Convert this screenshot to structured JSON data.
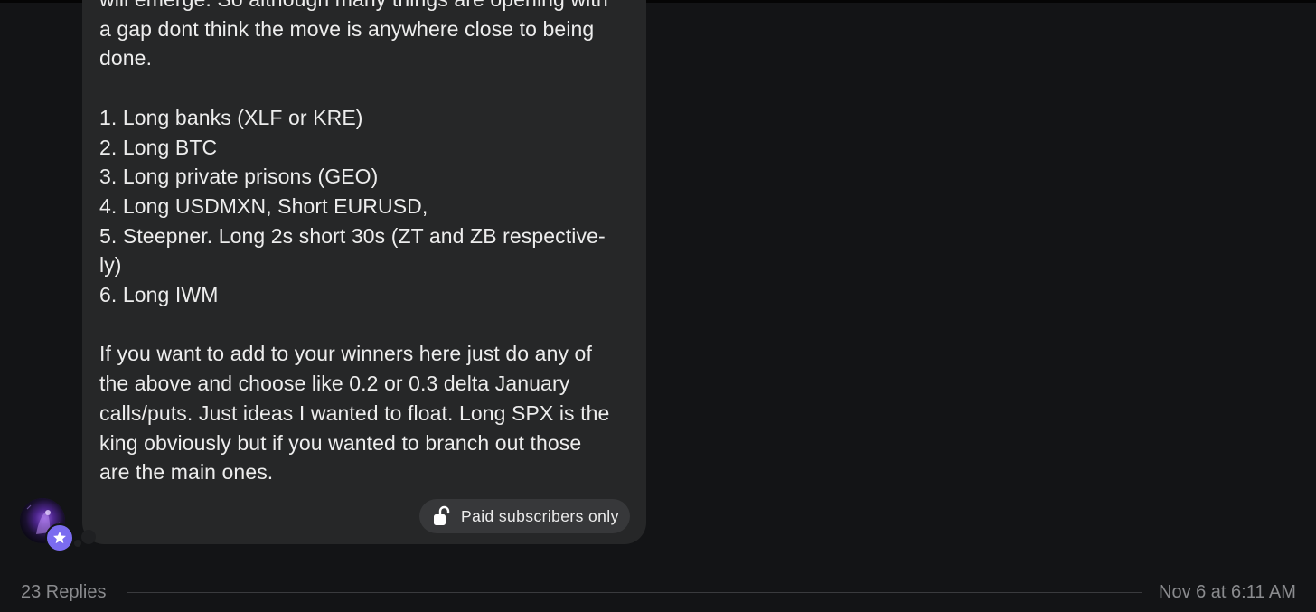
{
  "message": {
    "lines": [
      "will emerge. So although many things are opening with",
      "a gap dont think the move is anywhere close to being",
      "done.",
      "",
      "1. Long banks (XLF or KRE)",
      "2. Long BTC",
      "3. Long private prisons (GEO)",
      "4. Long USDMXN, Short EURUSD,",
      "5. Steepner. Long 2s short 30s (ZT and ZB respective-",
      "ly)",
      "6. Long IWM",
      "",
      "If you want to add to your winners here just do any of",
      "the above and choose like 0.2 or 0.3 delta January",
      "calls/puts. Just ideas I wanted to float. Long SPX is the",
      "king obviously but if you wanted to branch out those",
      "are the main ones."
    ],
    "paid_badge": {
      "label": "Paid subscribers only",
      "icon": "unlock-icon"
    }
  },
  "author": {
    "avatar_icon": "avatar",
    "badge_icon": "star-icon",
    "badge_color": "#7b6cf0"
  },
  "footer": {
    "replies_label": "23 Replies",
    "timestamp": "Nov 6 at 6:11 AM"
  },
  "colors": {
    "background": "#131416",
    "bubble": "#262728",
    "badge": "#37383a",
    "muted_text": "#8a8b8e"
  }
}
